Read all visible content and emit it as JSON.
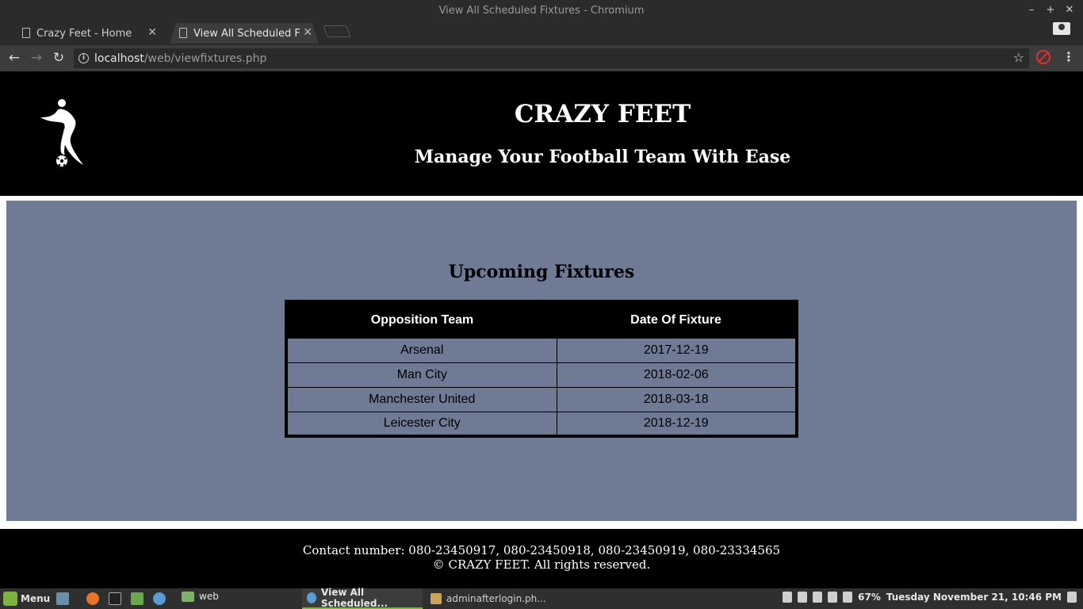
{
  "window": {
    "title": "View All Scheduled Fixtures - Chromium",
    "controls": {
      "minimize": "–",
      "maximize": "+",
      "close": "✕"
    }
  },
  "tabs": [
    {
      "label": "Crazy Feet - Home",
      "close": "✕"
    },
    {
      "label": "View All Scheduled Fixtures - Chromium",
      "close": "✕"
    }
  ],
  "toolbar": {
    "back": "←",
    "forward": "→",
    "reload": "↻",
    "url_host": "localhost",
    "url_path": "/web/viewfixtures.php",
    "info": "i",
    "star": "☆",
    "menu": "⋮"
  },
  "header": {
    "title": "CRAZY FEET",
    "tagline": "Manage Your Football Team With Ease"
  },
  "fixtures": {
    "heading": "Upcoming Fixtures",
    "columns": [
      "Opposition Team",
      "Date Of Fixture"
    ],
    "rows": [
      [
        "Arsenal",
        "2017-12-19"
      ],
      [
        "Man City",
        "2018-02-06"
      ],
      [
        "Manchester United",
        "2018-03-18"
      ],
      [
        "Leicester City",
        "2018-12-19"
      ]
    ]
  },
  "footer": {
    "contact": "Contact number: 080-23450917, 080-23450918, 080-23450919, 080-23334565",
    "copyright": "© CRAZY FEET. All rights reserved."
  },
  "taskbar": {
    "menu_label": "Menu",
    "folder_label": "web",
    "windows": [
      "View All Scheduled...",
      "adminafterlogin.ph..."
    ],
    "battery": "67%",
    "clock": "Tuesday November 21, 10:46 PM"
  }
}
